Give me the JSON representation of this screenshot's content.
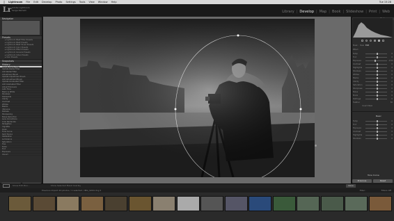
{
  "menubar": {
    "items": [
      "Lightroom",
      "File",
      "Edit",
      "Develop",
      "Photo",
      "Settings",
      "Tools",
      "View",
      "Window",
      "Help"
    ],
    "window_title": "Lightroom 6 Catalog.lrcat - Adobe Photoshop Lightroom - Develop",
    "clock": "Tue 15:28"
  },
  "identity": {
    "logo": "Lr",
    "line1": "Adobe Lightroom",
    "line2": "Serge Ramelli"
  },
  "modules": {
    "items": [
      "Library",
      "Develop",
      "Map",
      "Book",
      "Slideshow",
      "Print",
      "Web"
    ],
    "active": "Develop"
  },
  "left_panel": {
    "navigator": "Navigator",
    "presets": "Presets",
    "preset_items": [
      "Lightroom B&W Filter Presets",
      "Lightroom B&W Presets",
      "Lightroom B&W Toned Presets",
      "Lightroom Color Presets",
      "Lightroom Effect Presets",
      "Lightroom General Presets",
      "Lightroom Video Presets",
      "User Presets"
    ],
    "snapshots": "Snapshots",
    "history": "History",
    "history_items": [
      "Update Radial Filter",
      "Update Radial Filter",
      "Add Radial Filter",
      "Adjustment Brush",
      "Update Adjustment Brush",
      "Add Adjustment Brush",
      "Update Graduated Filter",
      "Add Graduated Filter",
      "Adjust Exposure",
      "Auto Tone",
      "Black & White",
      "Shadows",
      "Highlights",
      "Clarity",
      "Contrast",
      "Whites",
      "Blacks",
      "Vibrance",
      "Dehaze",
      "Sharpening",
      "Noise Reduction",
      "Lens Corrections",
      "Crop Rectangle",
      "Straighten",
      "Vignette",
      "Grain",
      "Tone Curve",
      "Split Toning",
      "Calibration",
      "Luminance",
      "Saturation",
      "Hue",
      "Temp",
      "Tint",
      "Exposure",
      "Import"
    ],
    "copy_button": "Copy...",
    "paste_button": "Paste"
  },
  "right_panel": {
    "histogram": "Histogram",
    "mask_label": "Mask :",
    "mask_new": "New",
    "mask_edit": "Edit",
    "effect_label": "Effect :",
    "sliders": [
      {
        "label": "Temp",
        "value": "0",
        "pos": 0.5
      },
      {
        "label": "Tint",
        "value": "0",
        "pos": 0.5
      },
      {
        "label": "Exposure",
        "value": "-0.54",
        "pos": 0.42
      },
      {
        "label": "Contrast",
        "value": "0",
        "pos": 0.5
      },
      {
        "label": "Highlights",
        "value": "0",
        "pos": 0.5
      },
      {
        "label": "Shadows",
        "value": "0",
        "pos": 0.5
      },
      {
        "label": "Whites",
        "value": "0",
        "pos": 0.5
      },
      {
        "label": "Blacks",
        "value": "0",
        "pos": 0.5
      },
      {
        "label": "Clarity",
        "value": "0",
        "pos": 0.5
      },
      {
        "label": "Saturation",
        "value": "0",
        "pos": 0.5
      },
      {
        "label": "Sharpness",
        "value": "0",
        "pos": 0.5
      },
      {
        "label": "Noise",
        "value": "0",
        "pos": 0.5
      },
      {
        "label": "Moiré",
        "value": "0",
        "pos": 0.5
      },
      {
        "label": "Defringe",
        "value": "0",
        "pos": 0.5
      }
    ],
    "feather_label": "Feather",
    "feather_value": "50",
    "invert_label": "Invert Mask",
    "basic_label": "Basic",
    "sliders2": [
      {
        "label": "Temp",
        "value": "0",
        "pos": 0.5
      },
      {
        "label": "Tint",
        "value": "0",
        "pos": 0.5
      },
      {
        "label": "Exposure",
        "value": "0",
        "pos": 0.5
      },
      {
        "label": "Contrast",
        "value": "0",
        "pos": 0.5
      },
      {
        "label": "Highlights",
        "value": "0",
        "pos": 0.5
      },
      {
        "label": "Shadows",
        "value": "0",
        "pos": 0.5
      }
    ],
    "tone_curve": "Tone Curve",
    "previous_button": "Previous",
    "reset_button": "Reset"
  },
  "toolbar": {
    "show_edit_pins": "Show Edit Pins :",
    "show_overlay": "Show Selected Mask Overlay",
    "done_button": "Done"
  },
  "filmstrip_bar": {
    "text": "Previous Import  20 photos / 1 selected / IMG_9204.dng ▾",
    "filter": "Filter :",
    "filter_value": "Filters Off"
  },
  "filmstrip": {
    "thumb_count": 16,
    "selected_index": 7
  }
}
